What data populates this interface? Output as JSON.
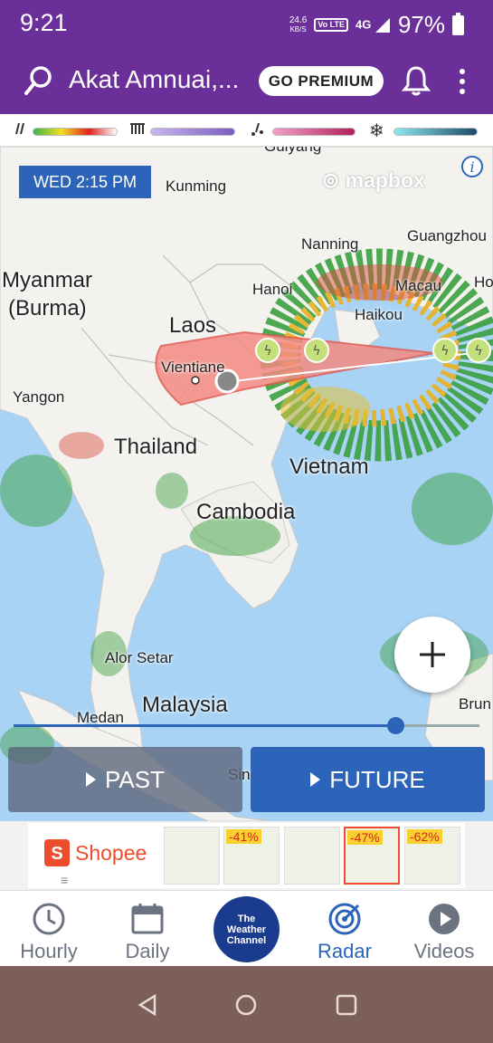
{
  "status": {
    "time": "9:21",
    "kbs_value": "24.6",
    "kbs_unit": "KB/S",
    "volte": "Vo LTE",
    "network": "4G",
    "battery": "97%"
  },
  "appbar": {
    "location": "Akat Amnuai,...",
    "premium_label": "GO PREMIUM"
  },
  "legend": {
    "colors": {
      "rain": [
        "#3cb44b",
        "#f0e020",
        "#e02020"
      ],
      "mix": "#a58bd6",
      "ice": "#e0609a",
      "snow": "#4ab8c8"
    }
  },
  "map": {
    "timestamp": "WED 2:15 PM",
    "attribution": "mapbox",
    "cities": [
      "Guiyang",
      "Kunming",
      "Nanning",
      "Guangzhou",
      "Hanoi",
      "Macau",
      "Ho",
      "Haikou",
      "Vientiane",
      "Yangon",
      "Alor Setar",
      "Medan",
      "Brun",
      "Sin"
    ],
    "countries": [
      "Myanmar",
      "(Burma)",
      "Laos",
      "Thailand",
      "Vietnam",
      "Cambodia",
      "Malaysia"
    ],
    "storm_track": {
      "cone_color": "#f28a82",
      "track_color": "#d03a2a",
      "marker_color": "#c4e07a"
    },
    "timeline_position_pct": 82
  },
  "controls": {
    "past_label": "PAST",
    "future_label": "FUTURE"
  },
  "ad": {
    "brand": "Shopee",
    "discounts": [
      "-41%",
      "-47%",
      "-62%"
    ],
    "brand_color": "#ee4d2d"
  },
  "nav": {
    "hourly": "Hourly",
    "daily": "Daily",
    "radar": "Radar",
    "videos": "Videos",
    "brand_line1": "The",
    "brand_line2": "Weather",
    "brand_line3": "Channel",
    "active_color": "#2b64b8"
  }
}
